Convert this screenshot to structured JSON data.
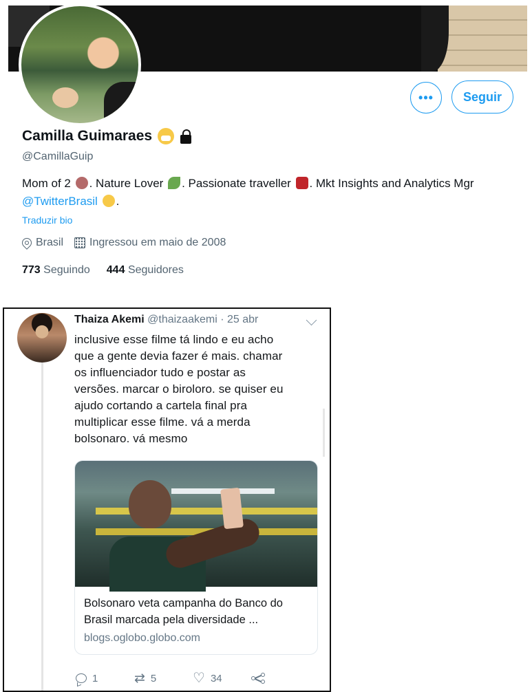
{
  "profile": {
    "name": "Camilla Guimaraes",
    "handle": "@CamillaGuip",
    "bio": {
      "part1": "Mom of 2",
      "part2": ". Nature Lover",
      "part3": ". Passionate traveller",
      "part4": ". Mkt Insights and Analytics Mgr",
      "mention": "@TwitterBrasil",
      "end": "."
    },
    "translate_label": "Traduzir bio",
    "location": "Brasil",
    "joined": "Ingressou em maio de 2008",
    "following_count": "773",
    "following_label": "Seguindo",
    "followers_count": "444",
    "followers_label": "Seguidores",
    "more_label": "•••",
    "follow_label": "Seguir"
  },
  "tweet": {
    "author": "Thaiza Akemi",
    "handle": "@thaizaakemi",
    "separator": "·",
    "date": "25 abr",
    "text": "inclusive esse filme tá lindo e eu acho\nque a gente devia fazer é mais. chamar\nos influenciador tudo e postar as\nversões. marcar o biroloro. se quiser eu\najudo cortando a cartela final pra\nmultiplicar esse filme. vá a merda\nbolsonaro. vá mesmo",
    "card": {
      "title": "Bolsonaro veta campanha do Banco do Brasil marcada pela diversidade ...",
      "url": "blogs.oglobo.globo.com"
    },
    "replies": "1",
    "retweets": "5",
    "likes": "34"
  },
  "colors": {
    "accent": "#1d9bf0",
    "text": "#0f1419",
    "muted": "#536471"
  }
}
